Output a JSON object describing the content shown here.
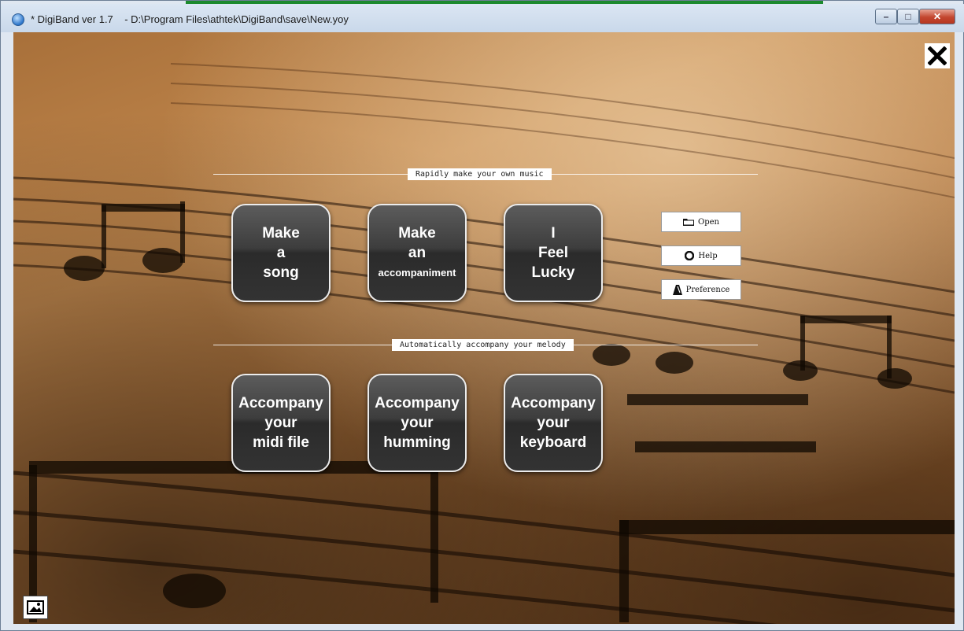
{
  "window": {
    "title": "* DigiBand ver 1.7    - D:\\Program Files\\athtek\\DigiBand\\save\\New.yoy",
    "minimize_glyph": "–",
    "maximize_glyph": "□",
    "close_glyph": "✕"
  },
  "sections": {
    "make": "Rapidly make your own music",
    "accompany": "Automatically accompany your melody"
  },
  "make_buttons": [
    {
      "lines": [
        "Make",
        "a",
        "song"
      ]
    },
    {
      "lines": [
        "Make",
        "an",
        "accompaniment"
      ]
    },
    {
      "lines": [
        "I",
        "Feel",
        "Lucky"
      ]
    }
  ],
  "accompany_buttons": [
    {
      "lines": [
        "Accompany",
        "your",
        "midi file"
      ]
    },
    {
      "lines": [
        "Accompany",
        "your",
        "humming"
      ]
    },
    {
      "lines": [
        "Accompany",
        "your",
        "keyboard"
      ]
    }
  ],
  "side_buttons": {
    "open": "Open",
    "help": "Help",
    "preference": "Preference"
  },
  "icons": {
    "app": "app-globe-icon",
    "close_content": "close-x-icon",
    "background_image": "image-icon",
    "open": "folder-icon",
    "help": "lifebuoy-icon",
    "preference": "metronome-icon"
  },
  "colors": {
    "accent_bar": "#1c8a2e",
    "button_face": "#3d3d3d",
    "button_border": "#ececec",
    "background": "#b0733b"
  }
}
